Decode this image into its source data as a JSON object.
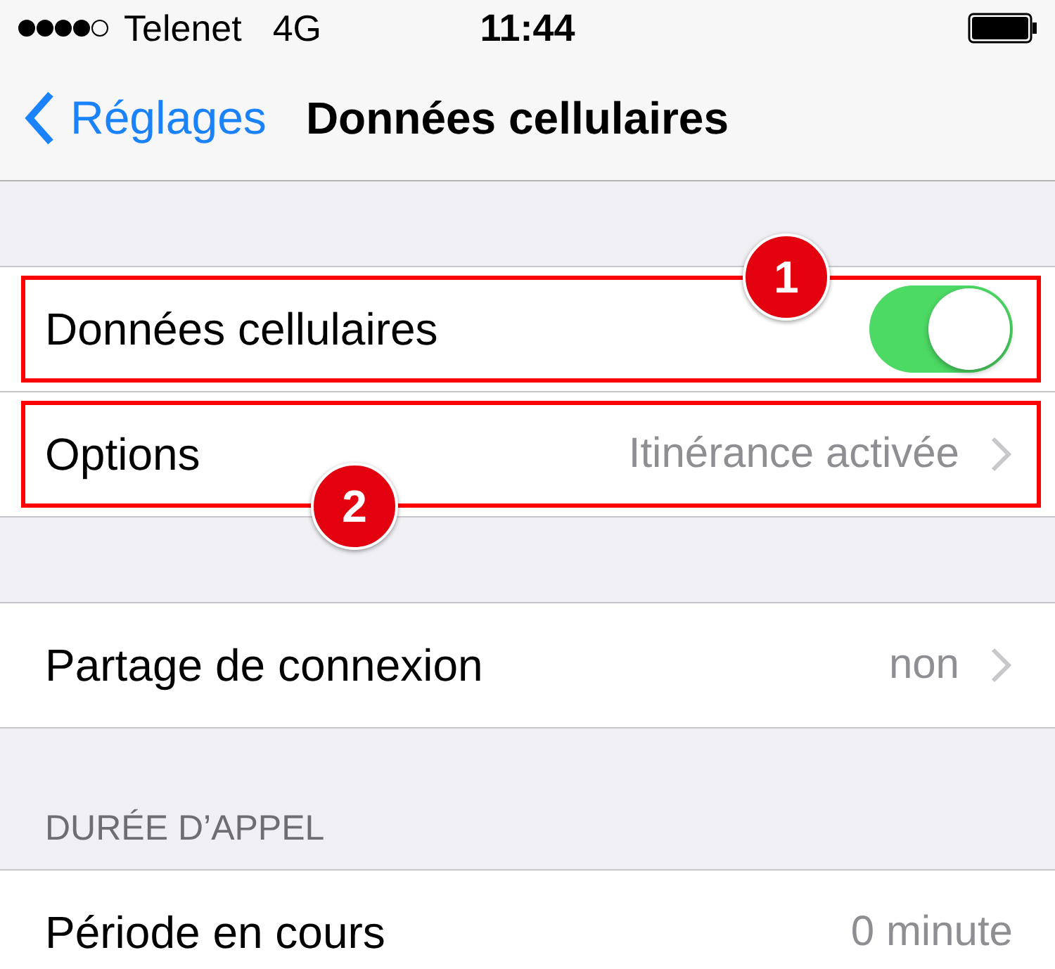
{
  "status_bar": {
    "carrier": "Telenet",
    "network": "4G",
    "time": "11:44"
  },
  "nav": {
    "back": "Réglages",
    "title": "Données cellulaires"
  },
  "groups": [
    {
      "rows": [
        {
          "kind": "toggle",
          "label": "Données cellulaires",
          "on": true,
          "callout": "1"
        },
        {
          "kind": "link",
          "label": "Options",
          "value": "Itinérance activée",
          "callout": "2"
        }
      ]
    },
    {
      "rows": [
        {
          "kind": "link",
          "label": "Partage de connexion",
          "value": "non"
        }
      ]
    },
    {
      "header": "DURÉE D’APPEL",
      "rows": [
        {
          "kind": "value",
          "label": "Période en cours",
          "value": "0 minute"
        }
      ]
    }
  ]
}
